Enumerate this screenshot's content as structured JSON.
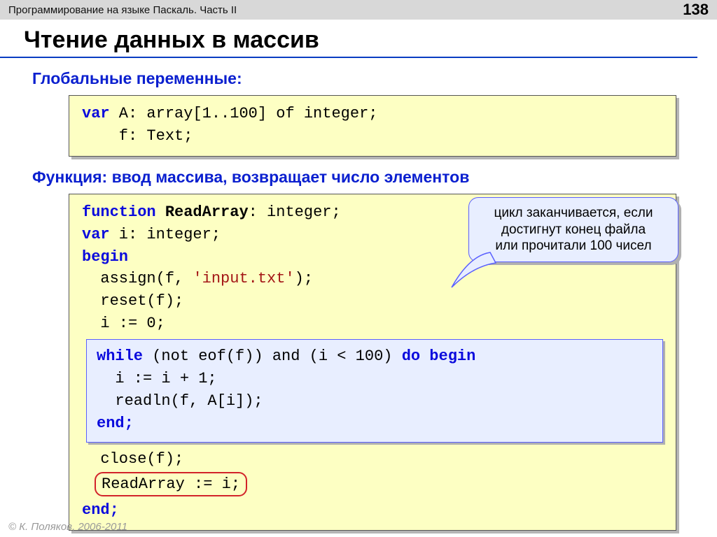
{
  "header": {
    "course": "Программирование на языке Паскаль. Часть II",
    "page": "138"
  },
  "title": "Чтение данных в массив",
  "sub1": "Глобальные переменные:",
  "varbox": {
    "l1_pre": "var",
    "l1_post": " A: array[1..100] of integer;",
    "l2": "    f: Text;"
  },
  "sub2": "Функция: ввод массива, возвращает число элементов",
  "func": {
    "l1a": "function",
    "l1b": " ReadArray",
    "l1c": ": integer;",
    "l2a": "var",
    "l2b": " i: integer;",
    "l3": "begin",
    "l4a": "  assign(f, ",
    "l4b": "'input.txt'",
    "l4c": ");",
    "l5": "  reset(f);",
    "l6": "  i := 0;",
    "inner": {
      "l1a": "while",
      "l1b": " (not eof(f)) and (i < 100) ",
      "l1c": "do begin",
      "l2": "  i := i + 1;",
      "l3": "  readln(f, A[i]);",
      "l4": "end;"
    },
    "l7": "  close(f);",
    "l8": "ReadArray := i;",
    "l9": "end;"
  },
  "callout": {
    "l1": "цикл заканчивается, если",
    "l2": "достигнут конец файла",
    "l3": "или прочитали 100 чисел"
  },
  "footer": "© К. Поляков, 2006-2011"
}
